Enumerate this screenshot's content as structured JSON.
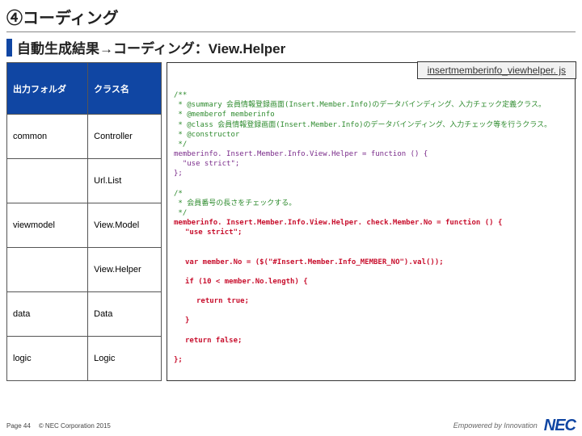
{
  "title": "④コーディング",
  "subtitle": "自動生成結果→コーディング：View.Helper",
  "table": {
    "h1": "出力フォルダ",
    "h2": "クラス名",
    "rows": [
      {
        "c1": "common",
        "c2": "Controller"
      },
      {
        "c1": "",
        "c2": "Url.List"
      },
      {
        "c1": "viewmodel",
        "c2": "View.Model"
      },
      {
        "c1": "",
        "c2": "View.Helper"
      },
      {
        "c1": "data",
        "c2": "Data"
      },
      {
        "c1": "logic",
        "c2": "Logic"
      }
    ]
  },
  "code": {
    "filename": "insertmemberinfo_viewhelper. js",
    "c1": "/**",
    "c2": " * @summary 会員情報登録画面(Insert.Member.Info)のデータバインディング、入力チェック定義クラス。",
    "c3": " * @memberof memberinfo",
    "c4": " * @class 会員情報登録画面(Insert.Member.Info)のデータバインディング、入力チェック等を行うクラス。",
    "c5": " * @constructor",
    "c6": " */",
    "j1": "memberinfo. Insert.Member.Info.View.Helper = function () {",
    "j2": "  \"use strict\";",
    "j3": "};",
    "c7": "/*",
    "c8": " * 会員番号の長さをチェックする。",
    "c9": " */",
    "r1": "memberinfo. Insert.Member.Info.View.Helper. check.Member.No = function () {",
    "r2": "\"use strict\";",
    "r3": "var member.No = ($(\"#Insert.Member.Info_MEMBER_NO\").val());",
    "r4": "if (10 < member.No.length) {",
    "r5": "return true;",
    "r6": "}",
    "r7": "return false;",
    "r8": "};"
  },
  "footer": {
    "page": "Page 44",
    "copy": "© NEC Corporation 2015",
    "tag": "Empowered by Innovation",
    "logo": "NEC"
  }
}
